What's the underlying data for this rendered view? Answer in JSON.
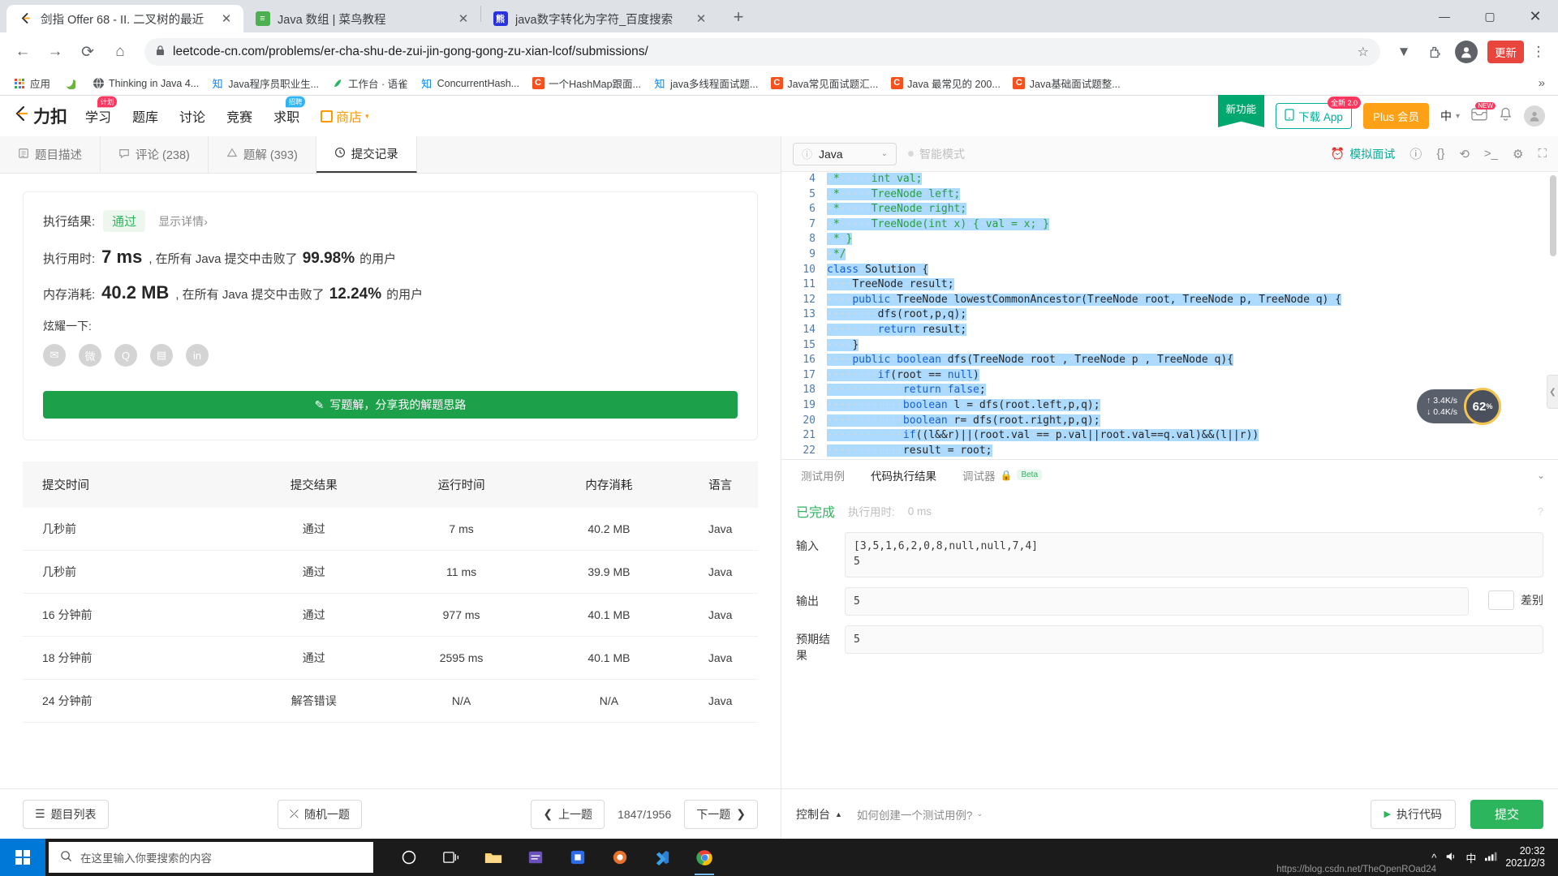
{
  "browser": {
    "tabs": [
      {
        "title": "剑指 Offer 68 - II. 二叉树的最近",
        "favicon": "leetcode-icon",
        "active": true,
        "close": "✕"
      },
      {
        "title": "Java 数组 | 菜鸟教程",
        "favicon": "runoob-icon",
        "active": false,
        "close": "✕"
      },
      {
        "title": "java数字转化为字符_百度搜索",
        "favicon": "baidu-icon",
        "active": false,
        "close": "✕"
      }
    ],
    "newtab_label": "+",
    "window_controls": {
      "minimize": "—",
      "maximize": "▢",
      "close": "✕"
    },
    "nav": {
      "back": "←",
      "forward": "→",
      "reload": "⟳",
      "home": "⌂"
    },
    "omnibox": {
      "lock": "🔒",
      "url": "leetcode-cn.com/problems/er-cha-shu-de-zui-jin-gong-gong-zu-xian-lcof/submissions/",
      "star": "☆"
    },
    "toolbar_right": {
      "extension": "▼",
      "puzzle": "🧩",
      "profile": "👤",
      "update_label": "更新",
      "menu": "⋮"
    },
    "bookmarks": [
      {
        "label": "应用",
        "icon": "apps-grid-icon",
        "type": "grid"
      },
      {
        "label": "",
        "icon": "spring-icon",
        "type": "spring"
      },
      {
        "label": "Thinking in Java 4...",
        "icon": "globe-icon",
        "type": "globe"
      },
      {
        "label": "Java程序员职业生...",
        "icon": "zhihu-icon",
        "type": "zhihu"
      },
      {
        "label": "工作台 · 语雀",
        "icon": "yuque-icon",
        "type": "yuque"
      },
      {
        "label": "ConcurrentHash...",
        "icon": "zhihu-icon",
        "type": "zhihu"
      },
      {
        "label": "一个HashMap跟面...",
        "icon": "csdn-icon",
        "type": "csdn"
      },
      {
        "label": "java多线程面试题...",
        "icon": "zhihu-icon",
        "type": "zhihu"
      },
      {
        "label": "Java常见面试题汇...",
        "icon": "csdn-icon",
        "type": "csdn"
      },
      {
        "label": "Java 最常见的 200...",
        "icon": "csdn-icon",
        "type": "csdn"
      },
      {
        "label": "Java基础面试题整...",
        "icon": "csdn-icon",
        "type": "csdn"
      }
    ],
    "bookmarks_overflow": "»"
  },
  "leetcode_header": {
    "logo": "力扣",
    "nav": [
      {
        "label": "学习",
        "badge": "计划",
        "badge_color": "pink"
      },
      {
        "label": "题库",
        "badge": "",
        "badge_color": ""
      },
      {
        "label": "讨论",
        "badge": "",
        "badge_color": ""
      },
      {
        "label": "竞赛",
        "badge": "",
        "badge_color": ""
      },
      {
        "label": "求职",
        "badge": "招聘",
        "badge_color": "blue"
      }
    ],
    "shop": "商店",
    "new_feature": "新功能",
    "download_app": "下载 App",
    "download_badge": "全新 2.0",
    "plus_member": "Plus 会员",
    "language": "中",
    "notify_badge": "NEW"
  },
  "problem_tabs": [
    {
      "label": "题目描述",
      "icon": "document-icon",
      "active": false
    },
    {
      "label": "评论 (238)",
      "icon": "comment-icon",
      "active": false
    },
    {
      "label": "题解 (393)",
      "icon": "solution-icon",
      "active": false
    },
    {
      "label": "提交记录",
      "icon": "clock-icon",
      "active": true
    }
  ],
  "result": {
    "exec_result_label": "执行结果:",
    "status": "通过",
    "show_detail": "显示详情",
    "show_detail_arrow": "›",
    "runtime_label": "执行用时:",
    "runtime_value": "7 ms",
    "runtime_text_a": ", 在所有 Java 提交中击败了",
    "runtime_percent": "99.98%",
    "runtime_text_b": "的用户",
    "memory_label": "内存消耗:",
    "memory_value": "40.2 MB",
    "memory_text_a": ", 在所有 Java 提交中击败了",
    "memory_percent": "12.24%",
    "memory_text_b": "的用户",
    "brag_label": "炫耀一下:",
    "socials": [
      "wechat-icon",
      "weibo-icon",
      "qq-icon",
      "qzone-icon",
      "linkedin-icon"
    ],
    "write_solution": "写题解，分享我的解题思路",
    "write_solution_icon": "pencil-icon"
  },
  "submissions_table": {
    "headers": [
      "提交时间",
      "提交结果",
      "运行时间",
      "内存消耗",
      "语言"
    ],
    "rows": [
      {
        "time": "几秒前",
        "result": "通过",
        "status": "pass",
        "runtime": "7 ms",
        "memory": "40.2 MB",
        "lang": "Java"
      },
      {
        "time": "几秒前",
        "result": "通过",
        "status": "pass",
        "runtime": "11 ms",
        "memory": "39.9 MB",
        "lang": "Java"
      },
      {
        "time": "16 分钟前",
        "result": "通过",
        "status": "pass",
        "runtime": "977 ms",
        "memory": "40.1 MB",
        "lang": "Java"
      },
      {
        "time": "18 分钟前",
        "result": "通过",
        "status": "pass",
        "runtime": "2595 ms",
        "memory": "40.1 MB",
        "lang": "Java"
      },
      {
        "time": "24 分钟前",
        "result": "解答错误",
        "status": "wrong",
        "runtime": "N/A",
        "memory": "N/A",
        "lang": "Java"
      }
    ]
  },
  "left_footer": {
    "problem_list": "题目列表",
    "problem_list_icon": "list-icon",
    "random": "随机一题",
    "random_icon": "shuffle-icon",
    "prev": "上一题",
    "prev_icon": "chevron-left-icon",
    "counter": "1847/1956",
    "next": "下一题",
    "next_icon": "chevron-right-icon"
  },
  "editor_bar": {
    "language": "Java",
    "info_icon": "info-icon",
    "caret": "⌄",
    "smart_mode": "智能模式",
    "mock_interview": "模拟面试",
    "mock_icon": "alarm-icon",
    "icons": [
      "info-icon",
      "format-braces-icon",
      "reset-icon",
      "terminal-icon",
      "settings-icon",
      "fullscreen-icon"
    ]
  },
  "code": {
    "first_line_number": 4,
    "lines": [
      {
        "n": 4,
        "text": " *     int val;",
        "kind": "comment",
        "sel_end": 15
      },
      {
        "n": 5,
        "text": " *     TreeNode left;",
        "kind": "comment",
        "sel_end": 21
      },
      {
        "n": 6,
        "text": " *     TreeNode right;",
        "kind": "comment",
        "sel_end": 22
      },
      {
        "n": 7,
        "text": " *     TreeNode(int x) { val = x; }",
        "kind": "comment",
        "sel_end": 34
      },
      {
        "n": 8,
        "text": " * }",
        "kind": "comment",
        "sel_end": 4
      },
      {
        "n": 9,
        "text": " */",
        "kind": "comment",
        "sel_end": 3
      },
      {
        "n": 10,
        "text": "class Solution {",
        "kind": "code",
        "sel_end": 16
      },
      {
        "n": 11,
        "text": "    TreeNode result;",
        "kind": "code",
        "sel_end": 20
      },
      {
        "n": 12,
        "text": "    public TreeNode lowestCommonAncestor(TreeNode root, TreeNode p, TreeNode q) {",
        "kind": "code",
        "sel_end": 79
      },
      {
        "n": 13,
        "text": "        dfs(root,p,q);",
        "kind": "code",
        "sel_end": 22
      },
      {
        "n": 14,
        "text": "        return result;",
        "kind": "code",
        "sel_end": 22
      },
      {
        "n": 15,
        "text": "    }",
        "kind": "code",
        "sel_end": 5
      },
      {
        "n": 16,
        "text": "    public boolean dfs(TreeNode root , TreeNode p , TreeNode q){",
        "kind": "code",
        "sel_end": 62
      },
      {
        "n": 17,
        "text": "        if(root == null)",
        "kind": "code",
        "sel_end": 24
      },
      {
        "n": 18,
        "text": "            return false;",
        "kind": "code",
        "sel_end": 25
      },
      {
        "n": 19,
        "text": "            boolean l = dfs(root.left,p,q);",
        "kind": "code",
        "sel_end": 43
      },
      {
        "n": 20,
        "text": "            boolean r= dfs(root.right,p,q);",
        "kind": "code",
        "sel_end": 43
      },
      {
        "n": 21,
        "text": "            if((l&&r)||(root.val == p.val||root.val==q.val)&&(l||r))",
        "kind": "code",
        "sel_end": 68
      },
      {
        "n": 22,
        "text": "            result = root;",
        "kind": "code",
        "sel_end": 26
      }
    ]
  },
  "perf_badge": {
    "upload_rate": "3.4K/s",
    "download_rate": "0.4K/s",
    "percent": "62",
    "percent_sup": "%",
    "up_arrow": "↑",
    "down_arrow": "↓"
  },
  "console": {
    "tabs": [
      {
        "label": "测试用例",
        "active": false
      },
      {
        "label": "代码执行结果",
        "active": true
      },
      {
        "label": "调试器",
        "active": false,
        "lock": "🔒",
        "beta": "Beta"
      }
    ],
    "collapse_icon": "⌄",
    "status": "已完成",
    "exec_time_label": "执行用时:",
    "exec_time_value": "0 ms",
    "help_icon": "?",
    "input_label": "输入",
    "input_value": "[3,5,1,6,2,0,8,null,null,7,4]\n5",
    "output_label": "输出",
    "output_value": "5",
    "expected_label": "预期结果",
    "expected_value": "5",
    "diff_label": "差别"
  },
  "console_footer": {
    "console_label": "控制台",
    "console_icon": "▲",
    "hint": "如何创建一个测试用例?",
    "hint_caret": "⌄",
    "run_code": "执行代码",
    "run_icon": "▶",
    "submit": "提交"
  },
  "taskbar": {
    "search_placeholder": "在这里输入你要搜索的内容",
    "search_icon": "search-icon",
    "items": [
      {
        "name": "cortana-icon",
        "glyph": "◯"
      },
      {
        "name": "task-view-icon",
        "glyph": "❐"
      },
      {
        "name": "file-explorer-icon",
        "glyph": "🗀"
      },
      {
        "name": "app-icon-purple",
        "glyph": "▤"
      },
      {
        "name": "app-icon-blue",
        "glyph": "▣"
      },
      {
        "name": "app-icon-orange",
        "glyph": "◉"
      },
      {
        "name": "vscode-icon",
        "glyph": "✕"
      },
      {
        "name": "chrome-icon",
        "glyph": "◍"
      }
    ],
    "tray": {
      "chevron": "^",
      "volume": "🔊",
      "ime": "中",
      "network": "📶"
    },
    "clock_time": "20:32",
    "clock_date": "2021/2/3",
    "watermark": "https://blog.csdn.net/TheOpenROad24"
  },
  "colors": {
    "green": "#2db55d",
    "orange": "#ffa116",
    "red": "#ef4743",
    "blue_select": "#addbff",
    "chrome_gray": "#dee1e6"
  }
}
